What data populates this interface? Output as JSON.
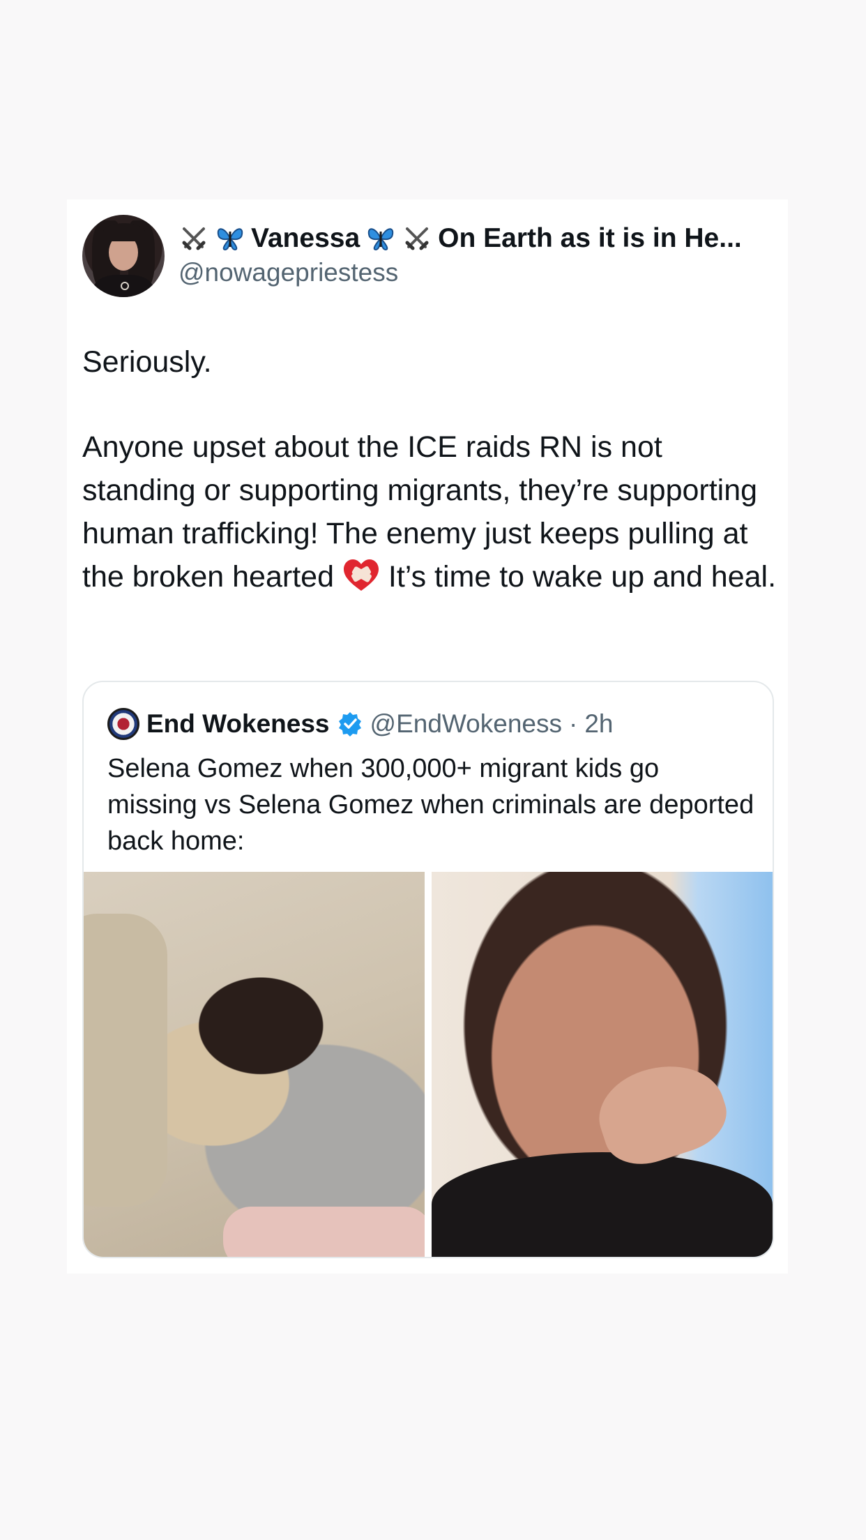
{
  "post": {
    "display_name_prefix_emoji": [
      "crossed-swords",
      "butterfly"
    ],
    "display_name": "Vanessa",
    "display_name_suffix_emoji": [
      "butterfly",
      "crossed-swords"
    ],
    "display_name_tail": "On Earth as it is in He...",
    "handle": "@nowagepriestess",
    "text_line_1": "Seriously.",
    "text_body_before_emoji": "Anyone upset about the ICE raids RN is not standing or supporting migrants, they’re supporting human trafficking! The enemy just keeps pulling at the broken hearted",
    "text_emoji": "mending-heart",
    "text_body_after_emoji": " It’s time to wake up and heal."
  },
  "quoted_post": {
    "name": "End Wokeness",
    "verified": true,
    "handle": "@EndWokeness",
    "separator": "·",
    "time": "2h",
    "text": "Selena Gomez when 300,000+ migrant kids go missing vs Selena Gomez when criminals are deported back home:",
    "media": [
      {
        "icon": "photo-woman-cuddling-dog"
      },
      {
        "icon": "photo-woman-crying"
      }
    ]
  },
  "colors": {
    "background": "#f9f8f9",
    "card": "#ffffff",
    "text_primary": "#0f1419",
    "text_secondary": "#536471",
    "verified_blue": "#1d9bf0",
    "border": "#e4e8ea"
  }
}
